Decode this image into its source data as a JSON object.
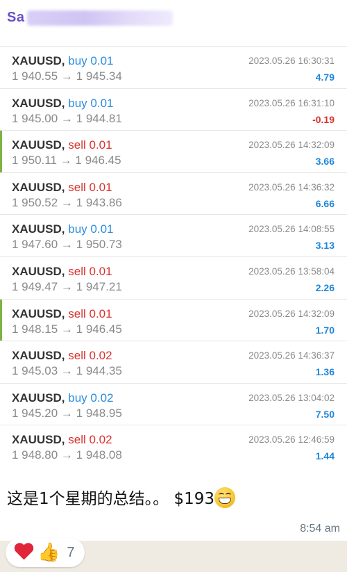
{
  "sender": {
    "name_visible": "Sa"
  },
  "trades": [
    {
      "symbol": "XAUUSD,",
      "side": "buy",
      "lots": "0.01",
      "open": "1 940.55",
      "close": "1 945.34",
      "time": "2023.05.26 16:30:31",
      "profit": "4.79",
      "flag": false
    },
    {
      "symbol": "XAUUSD,",
      "side": "buy",
      "lots": "0.01",
      "open": "1 945.00",
      "close": "1 944.81",
      "time": "2023.05.26 16:31:10",
      "profit": "-0.19",
      "flag": false
    },
    {
      "symbol": "XAUUSD,",
      "side": "sell",
      "lots": "0.01",
      "open": "1 950.11",
      "close": "1 946.45",
      "time": "2023.05.26 14:32:09",
      "profit": "3.66",
      "flag": true
    },
    {
      "symbol": "XAUUSD,",
      "side": "sell",
      "lots": "0.01",
      "open": "1 950.52",
      "close": "1 943.86",
      "time": "2023.05.26 14:36:32",
      "profit": "6.66",
      "flag": false
    },
    {
      "symbol": "XAUUSD,",
      "side": "buy",
      "lots": "0.01",
      "open": "1 947.60",
      "close": "1 950.73",
      "time": "2023.05.26 14:08:55",
      "profit": "3.13",
      "flag": false
    },
    {
      "symbol": "XAUUSD,",
      "side": "sell",
      "lots": "0.01",
      "open": "1 949.47",
      "close": "1 947.21",
      "time": "2023.05.26 13:58:04",
      "profit": "2.26",
      "flag": false
    },
    {
      "symbol": "XAUUSD,",
      "side": "sell",
      "lots": "0.01",
      "open": "1 948.15",
      "close": "1 946.45",
      "time": "2023.05.26 14:32:09",
      "profit": "1.70",
      "flag": true
    },
    {
      "symbol": "XAUUSD,",
      "side": "sell",
      "lots": "0.02",
      "open": "1 945.03",
      "close": "1 944.35",
      "time": "2023.05.26 14:36:37",
      "profit": "1.36",
      "flag": false
    },
    {
      "symbol": "XAUUSD,",
      "side": "buy",
      "lots": "0.02",
      "open": "1 945.20",
      "close": "1 948.95",
      "time": "2023.05.26 13:04:02",
      "profit": "7.50",
      "flag": false
    },
    {
      "symbol": "XAUUSD,",
      "side": "sell",
      "lots": "0.02",
      "open": "1 948.80",
      "close": "1 948.08",
      "time": "2023.05.26 12:46:59",
      "profit": "1.44",
      "flag": false
    }
  ],
  "arrow": "→",
  "message": {
    "text": "这是1个星期的总结。。 $193",
    "emoji": "grinning-face-with-smiling-eyes"
  },
  "timestamp": "8:54 am",
  "reactions": {
    "icons": [
      "heart-icon",
      "thumbs-up-icon"
    ],
    "count": "7"
  },
  "colors": {
    "buy": "#2c8ce0",
    "sell": "#d9322e",
    "profit_pos": "#1f86db",
    "profit_neg": "#d9322e",
    "flag": "#7cb342",
    "sender": "#6a4fc8"
  }
}
